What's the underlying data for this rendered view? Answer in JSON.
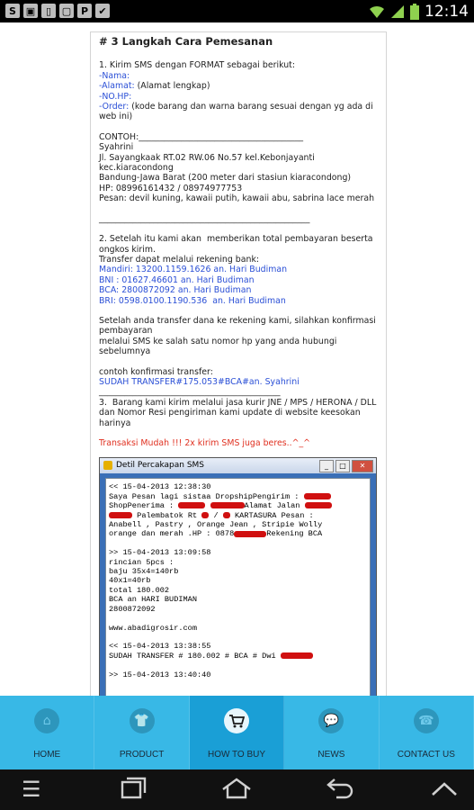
{
  "statusbar": {
    "left_icons": [
      "S",
      "▣",
      "▯",
      "▢",
      "P",
      "✔"
    ],
    "time": "12:14"
  },
  "doc": {
    "title": "# 3 Langkah Cara Pemesanan",
    "step1_intro": "1. Kirim SMS dengan FORMAT sebagai berikut:",
    "fmt_nama": "-Nama:",
    "fmt_alamat_label": "-Alamat:",
    "fmt_alamat_note": " (Alamat lengkap)",
    "fmt_nohp": "-NO.HP:",
    "fmt_order_label": "-Order:",
    "fmt_order_note": " (kode barang dan warna barang sesuai dengan yg ada di web ini)",
    "contoh_header": "CONTOH:_______________________________________",
    "contoh_name": "Syahrini",
    "contoh_addr1": "Jl. Sayangkaak RT.02 RW.06 No.57 kel.Kebonjayanti kec.kiaracondong",
    "contoh_addr2": "Bandung-Jawa Barat (200 meter dari stasiun kiaracondong)",
    "contoh_hp": "HP: 08996161432 / 08974977753",
    "contoh_pesan": "Pesan: devil kuning, kawaii putih, kawaii abu, sabrina lace merah",
    "divider1": "__________________________________________________",
    "step2_intro": "2. Setelah itu kami akan  memberikan total pembayaran beserta ongkos kirim.",
    "transfer_intro": "Transfer dapat melalui rekening bank:",
    "bank_mandiri": "Mandiri: 13200.1159.1626 an. Hari Budiman",
    "bank_bni": "BNI : 01627.46601 an. Hari Budiman",
    "bank_bca": "BCA: 2800872092 an. Hari Budiman",
    "bank_bri": "BRI: 0598.0100.1190.536  an. Hari Budiman",
    "konfirmasi1": "Setelah anda transfer dana ke rekening kami, silahkan konfirmasi pembayaran",
    "konfirmasi2": "melalui SMS ke salah satu nomor hp yang anda hubungi sebelumnya",
    "contoh_konf": "contoh konfirmasi transfer:",
    "contoh_konf_value": "SUDAH TRANSFER#175.053#BCA#an. Syahrini",
    "divider2": "___________________________________________",
    "step3": "3.  Barang kami kirim melalui jasa kurir JNE / MPS / HERONA / DLL dan Nomor Resi pengiriman kami update di website keesokan harinya",
    "promo": "Transaksi Mudah !!! 2x kirim SMS juga beres..^_^"
  },
  "sms_window": {
    "title": "Detil Percakapan SMS",
    "btn_min": "_",
    "btn_max": "□",
    "btn_close": "✕",
    "l1": "<< 15-04-2013 12:38:30",
    "l2": "Saya Pesan lagi sistaa DropshipPengirim : ",
    "l3a": "ShopPenerima : ",
    "l3b": "Alamat Jalan ",
    "l4a": " Palembatok Rt ",
    "l4b": " / ",
    "l4c": " KARTASURA Pesan :",
    "l5": "Anabell , Pastry , Orange Jean , Stripie Wolly",
    "l6a": "orange dan merah .HP : 0878",
    "l6b": "Rekening BCA",
    "l7": "",
    "l8": ">> 15-04-2013 13:09:58",
    "l9": "rincian 5pcs :",
    "l10": "baju 35x4=140rb",
    "l11": "40x1=40rb",
    "l12": "total 180.002",
    "l13": "BCA an HARI BUDIMAN",
    "l14": "2800872092",
    "l15": "",
    "l16": "www.abadigrosir.com",
    "l17": "",
    "l18": "<< 15-04-2013 13:38:55",
    "l19": "SUDAH TRANSFER # 180.002 # BCA # Dwi ",
    "l20": "",
    "l21": ">> 15-04-2013 13:40:40"
  },
  "tabs": [
    {
      "label": "HOME",
      "icon": "home-icon"
    },
    {
      "label": "PRODUCT",
      "icon": "shirt-icon"
    },
    {
      "label": "HOW TO BUY",
      "icon": "cart-icon"
    },
    {
      "label": "NEWS",
      "icon": "chat-icon"
    },
    {
      "label": "CONTACT US",
      "icon": "phone-icon"
    }
  ],
  "active_tab": "HOW TO BUY",
  "colors": {
    "tabbar": "#38b8e6",
    "tab_active": "#1a9fd6",
    "link_blue": "#2a4fd6",
    "promo_red": "#e03020"
  }
}
